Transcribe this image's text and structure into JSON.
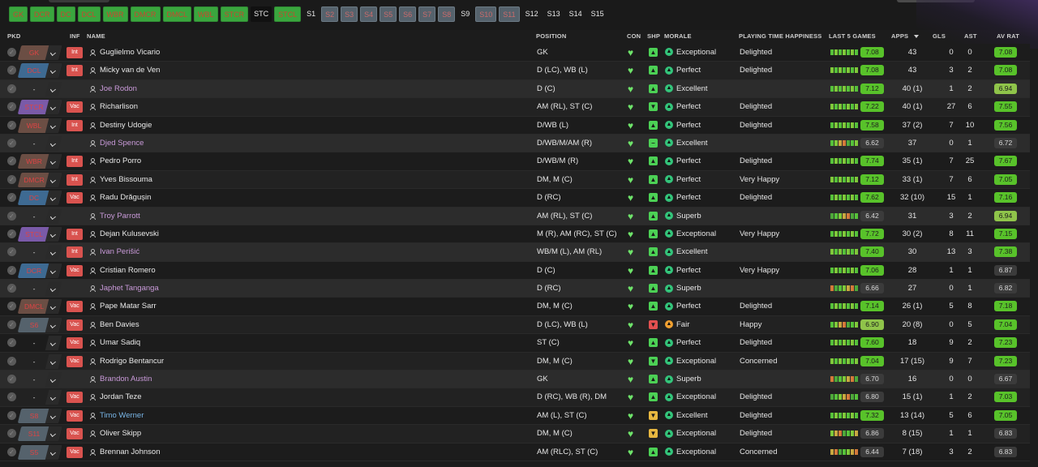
{
  "filters": [
    "GK",
    "DCR",
    "DC",
    "DCL",
    "WBR",
    "DMCR",
    "DMCL",
    "WBL",
    "STCR",
    "STC",
    "STCL",
    "S1",
    "S2",
    "S3",
    "S4",
    "S5",
    "S6",
    "S7",
    "S8",
    "S9",
    "S10",
    "S11",
    "S12",
    "S13",
    "S14",
    "S15"
  ],
  "headers": {
    "pkd": "PKD",
    "inf": "INF",
    "name": "NAME",
    "position": "POSITION",
    "con": "CON",
    "shp": "SHP",
    "morale": "MORALE",
    "pth": "PLAYING TIME HAPPINESS",
    "last5": "LAST 5 GAMES",
    "apps": "APPS",
    "gls": "GLS",
    "ast": "AST",
    "avrat": "AV RAT"
  },
  "colors": {
    "green": "#3aa63e",
    "lime": "#58c22a",
    "yellow_green": "#9acd32",
    "morale_green": "#33c47a",
    "morale_orange": "#f0a030",
    "injury_red": "#d9534f",
    "heart": "#6ee36a",
    "loan_name": "#c99ad9",
    "blue_name": "#79b5e6"
  },
  "players": [
    {
      "pkd": "GK",
      "inf": "Int",
      "name": "Guglielmo Vicario",
      "position": "GK",
      "shp": "up",
      "morale": "Exceptional",
      "pth": "Delighted",
      "last5": "7.08",
      "apps": "43",
      "gls": "0",
      "ast": "0",
      "avrat": "7.08"
    },
    {
      "pkd": "DCL",
      "inf": "Int",
      "name": "Micky van de Ven",
      "position": "D (LC), WB (L)",
      "shp": "up",
      "morale": "Perfect",
      "pth": "Delighted",
      "last5": "7.08",
      "apps": "43",
      "gls": "3",
      "ast": "2",
      "avrat": "7.08"
    },
    {
      "pkd": "-",
      "inf": "",
      "name": "Joe Rodon",
      "position": "D (C)",
      "shp": "up",
      "morale": "Excellent",
      "pth": "",
      "last5": "7.12",
      "apps": "40 (1)",
      "gls": "1",
      "ast": "2",
      "avrat": "6.94",
      "loan": true
    },
    {
      "pkd": "STCR",
      "inf": "Vac",
      "name": "Richarlison",
      "position": "AM (RL), ST (C)",
      "shp": "down",
      "morale": "Perfect",
      "pth": "Delighted",
      "last5": "7.22",
      "apps": "40 (1)",
      "gls": "27",
      "ast": "6",
      "avrat": "7.55"
    },
    {
      "pkd": "WBL",
      "inf": "Int",
      "name": "Destiny Udogie",
      "position": "D/WB (L)",
      "shp": "up",
      "morale": "Perfect",
      "pth": "Delighted",
      "last5": "7.58",
      "apps": "37 (2)",
      "gls": "7",
      "ast": "10",
      "avrat": "7.56"
    },
    {
      "pkd": "-",
      "inf": "",
      "name": "Djed Spence",
      "position": "D/WB/M/AM (R)",
      "shp": "neutral",
      "morale": "Excellent",
      "pth": "",
      "last5": "6.62",
      "apps": "37",
      "gls": "0",
      "ast": "1",
      "avrat": "6.72",
      "loan": true
    },
    {
      "pkd": "WBR",
      "inf": "Int",
      "name": "Pedro Porro",
      "position": "D/WB/M (R)",
      "shp": "up",
      "morale": "Perfect",
      "pth": "Delighted",
      "last5": "7.74",
      "apps": "35 (1)",
      "gls": "7",
      "ast": "25",
      "avrat": "7.67"
    },
    {
      "pkd": "DMCR",
      "inf": "Int",
      "name": "Yves Bissouma",
      "position": "DM, M (C)",
      "shp": "up",
      "morale": "Perfect",
      "pth": "Very Happy",
      "last5": "7.12",
      "apps": "33 (1)",
      "gls": "7",
      "ast": "6",
      "avrat": "7.05"
    },
    {
      "pkd": "DC",
      "inf": "Vac",
      "name": "Radu Drăgușin",
      "position": "D (RC)",
      "shp": "up",
      "morale": "Perfect",
      "pth": "Delighted",
      "last5": "7.62",
      "apps": "32 (10)",
      "gls": "15",
      "ast": "1",
      "avrat": "7.16"
    },
    {
      "pkd": "-",
      "inf": "",
      "name": "Troy Parrott",
      "position": "AM (RL), ST (C)",
      "shp": "up",
      "morale": "Superb",
      "pth": "",
      "last5": "6.42",
      "apps": "31",
      "gls": "3",
      "ast": "2",
      "avrat": "6.94",
      "loan": true
    },
    {
      "pkd": "STCL",
      "inf": "Int",
      "name": "Dejan Kulusevski",
      "position": "M (R), AM (RC), ST (C)",
      "shp": "up",
      "morale": "Exceptional",
      "pth": "Very Happy",
      "last5": "7.72",
      "apps": "30 (2)",
      "gls": "8",
      "ast": "11",
      "avrat": "7.15"
    },
    {
      "pkd": "-",
      "inf": "Int",
      "name": "Ivan Perišić",
      "position": "WB/M (L), AM (RL)",
      "shp": "up",
      "morale": "Excellent",
      "pth": "",
      "last5": "7.40",
      "apps": "30",
      "gls": "13",
      "ast": "3",
      "avrat": "7.38",
      "loan": true
    },
    {
      "pkd": "DCR",
      "inf": "Vac",
      "name": "Cristian Romero",
      "position": "D (C)",
      "shp": "up",
      "morale": "Perfect",
      "pth": "Very Happy",
      "last5": "7.06",
      "apps": "28",
      "gls": "1",
      "ast": "1",
      "avrat": "6.87"
    },
    {
      "pkd": "-",
      "inf": "",
      "name": "Japhet Tanganga",
      "position": "D (RC)",
      "shp": "up",
      "morale": "Superb",
      "pth": "",
      "last5": "6.66",
      "apps": "27",
      "gls": "0",
      "ast": "1",
      "avrat": "6.82",
      "loan": true
    },
    {
      "pkd": "DMCL",
      "inf": "Vac",
      "name": "Pape Matar Sarr",
      "position": "DM, M (C)",
      "shp": "up",
      "morale": "Perfect",
      "pth": "Delighted",
      "last5": "7.14",
      "apps": "26 (1)",
      "gls": "5",
      "ast": "8",
      "avrat": "7.18"
    },
    {
      "pkd": "S6",
      "inf": "Vac",
      "name": "Ben Davies",
      "position": "D (LC), WB (L)",
      "shp": "red",
      "morale": "Fair",
      "pth": "Happy",
      "last5": "6.90",
      "apps": "20 (8)",
      "gls": "0",
      "ast": "5",
      "avrat": "7.04"
    },
    {
      "pkd": "-",
      "inf": "Vac",
      "name": "Umar Sadiq",
      "position": "ST (C)",
      "shp": "up",
      "morale": "Perfect",
      "pth": "Delighted",
      "last5": "7.60",
      "apps": "18",
      "gls": "9",
      "ast": "2",
      "avrat": "7.23"
    },
    {
      "pkd": "-",
      "inf": "Vac",
      "name": "Rodrigo Bentancur",
      "position": "DM, M (C)",
      "shp": "down",
      "morale": "Exceptional",
      "pth": "Concerned",
      "last5": "7.04",
      "apps": "17 (15)",
      "gls": "9",
      "ast": "7",
      "avrat": "7.23"
    },
    {
      "pkd": "-",
      "inf": "",
      "name": "Brandon Austin",
      "position": "GK",
      "shp": "up",
      "morale": "Superb",
      "pth": "",
      "last5": "6.70",
      "apps": "16",
      "gls": "0",
      "ast": "0",
      "avrat": "6.67",
      "loan": true
    },
    {
      "pkd": "-",
      "inf": "Vac",
      "name": "Jordan Teze",
      "position": "D (RC), WB (R), DM",
      "shp": "up",
      "morale": "Exceptional",
      "pth": "Delighted",
      "last5": "6.80",
      "apps": "15 (1)",
      "gls": "1",
      "ast": "2",
      "avrat": "7.03"
    },
    {
      "pkd": "S8",
      "inf": "Vac",
      "name": "Timo Werner",
      "position": "AM (L), ST (C)",
      "shp": "yellow",
      "morale": "Excellent",
      "pth": "Delighted",
      "last5": "7.32",
      "apps": "13 (14)",
      "gls": "5",
      "ast": "6",
      "avrat": "7.05",
      "blue": true
    },
    {
      "pkd": "S11",
      "inf": "Vac",
      "name": "Oliver Skipp",
      "position": "DM, M (C)",
      "shp": "yellow",
      "morale": "Exceptional",
      "pth": "Delighted",
      "last5": "6.86",
      "apps": "8 (15)",
      "gls": "1",
      "ast": "1",
      "avrat": "6.83"
    },
    {
      "pkd": "S5",
      "inf": "Vac",
      "name": "Brennan Johnson",
      "position": "AM (RLC), ST (C)",
      "shp": "up",
      "morale": "Exceptional",
      "pth": "Concerned",
      "last5": "6.44",
      "apps": "7 (18)",
      "gls": "3",
      "ast": "2",
      "avrat": "6.83"
    }
  ]
}
